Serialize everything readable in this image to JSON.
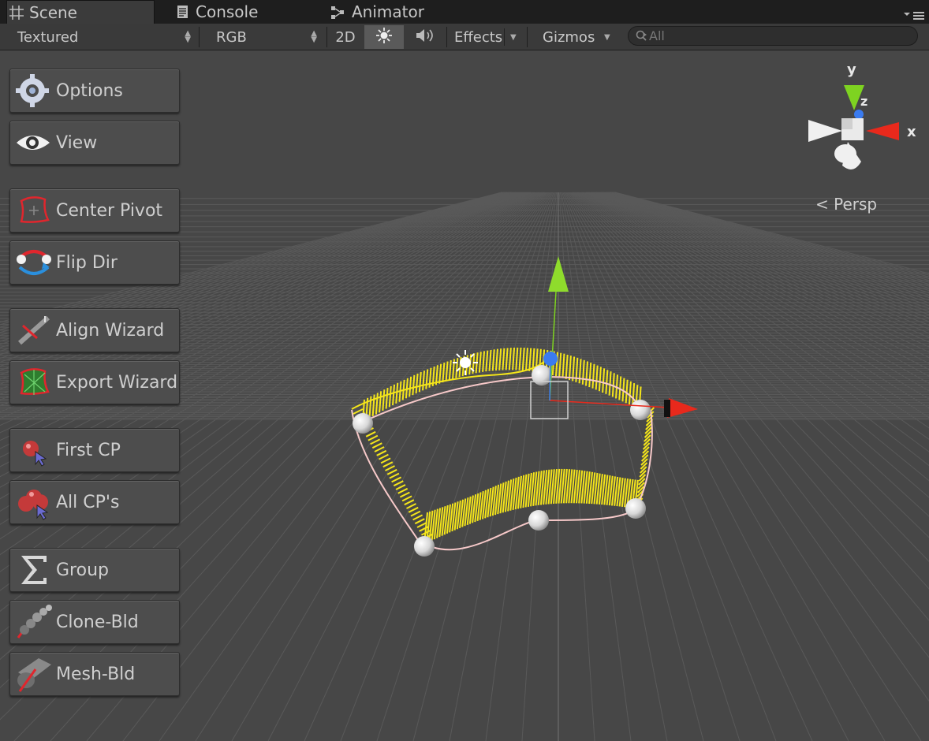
{
  "tabs": [
    {
      "label": "Scene",
      "icon": "grid-icon"
    },
    {
      "label": "Console",
      "icon": "console-icon"
    },
    {
      "label": "Animator",
      "icon": "animator-icon"
    }
  ],
  "toolbar": {
    "shading_mode": "Textured",
    "render_mode": "RGB",
    "mode_2d": "2D",
    "lighting_icon": "sun-icon",
    "audio_icon": "speaker-icon",
    "effects": "Effects",
    "gizmos": "Gizmos",
    "search_placeholder": "All"
  },
  "buttons": {
    "options": "Options",
    "view": "View",
    "center_pivot": "Center Pivot",
    "flip_dir": "Flip Dir",
    "align_wizard": "Align Wizard",
    "export_wizard": "Export Wizard",
    "first_cp": "First CP",
    "all_cps": "All CP's",
    "group": "Group",
    "clone_bld": "Clone-Bld",
    "mesh_bld": "Mesh-Bld"
  },
  "orientation_gizmo": {
    "x": "x",
    "y": "y",
    "z": "z",
    "projection": "Persp"
  },
  "colors": {
    "x_axis": "#e8291c",
    "y_axis": "#7ed321",
    "z_axis": "#3a7bf0",
    "spline": "#f5e61a"
  }
}
